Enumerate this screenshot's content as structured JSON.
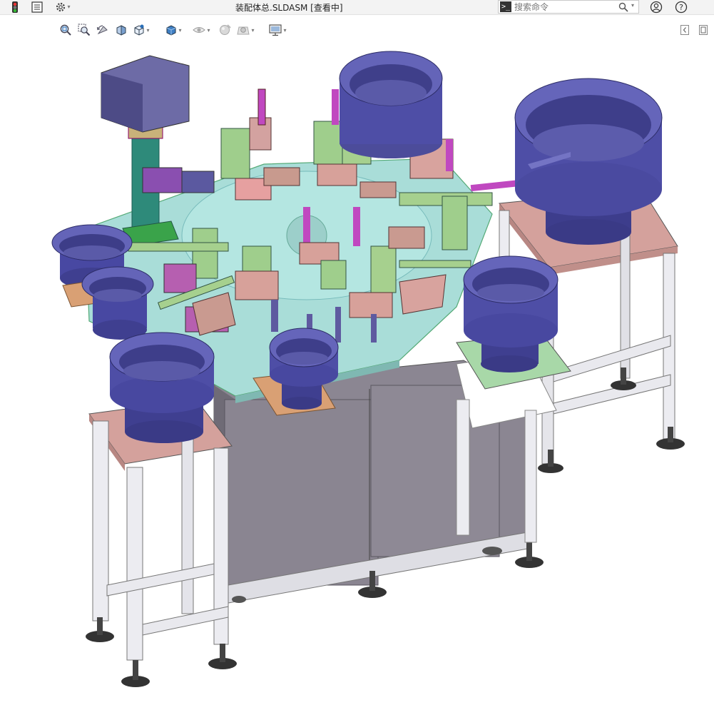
{
  "window": {
    "title": "装配体总.SLDASM [查看中]"
  },
  "search": {
    "placeholder": "搜索命令"
  },
  "icons": {
    "app": "traffic-light-icon",
    "feature_tree": "feature-tree-icon",
    "options": "gear-icon",
    "search_prompt": "command-prompt-icon",
    "search": "search-icon",
    "account": "user-icon",
    "help": "help-icon",
    "zoom_to_fit": "zoom-to-fit-icon",
    "zoom_area": "zoom-to-area-icon",
    "previous_view": "previous-view-icon",
    "section_view": "section-view-icon",
    "view_orientation": "view-orientation-icon",
    "display_style": "display-style-icon",
    "hide_show": "hide-show-items-icon",
    "appearance": "edit-appearance-icon",
    "scene": "apply-scene-icon",
    "view_settings": "view-settings-icon",
    "panel_collapse": "collapse-panel-icon",
    "panel_restore": "restore-panel-icon"
  },
  "colors": {
    "background": "#ffffff",
    "machine_table_top": "#a8dcd6",
    "bowl_feeder": "#4a4a9a",
    "stand_top": "#d09a96",
    "cabinet": "#8a8690",
    "frame": "#e8e8ee"
  }
}
